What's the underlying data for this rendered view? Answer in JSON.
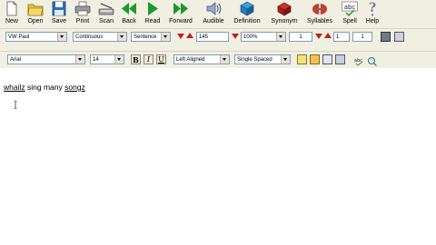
{
  "toolbar": {
    "new": "New",
    "open": "Open",
    "save": "Save",
    "print": "Print",
    "scan": "Scan",
    "back": "Back",
    "read": "Read",
    "forward": "Forward",
    "audible": "Audible",
    "definition": "Definition",
    "synonym": "Synonym",
    "syllables": "Syllables",
    "spell": "Spell",
    "help": "Help",
    "spell_icon_text": "abc"
  },
  "voice_bar": {
    "voice": "VW Paul",
    "reading_mode": "Continuous",
    "reading_unit": "Sentence",
    "speed": "145",
    "volume": "100%",
    "value_a": "1",
    "value_b": "1",
    "value_c": "1"
  },
  "format_bar": {
    "font": "Arial",
    "size": "14",
    "bold": "B",
    "italic": "I",
    "underline": "U",
    "alignment": "Left Aligned",
    "spacing": "Single Spaced"
  },
  "document": {
    "word1": "whailz",
    "word2": "sing",
    "word3": "many",
    "word4": "songz"
  },
  "colors": {
    "toolbar_bg": "#f1efe2",
    "arrow_red": "#c02020",
    "play_green": "#1a9a2a"
  }
}
